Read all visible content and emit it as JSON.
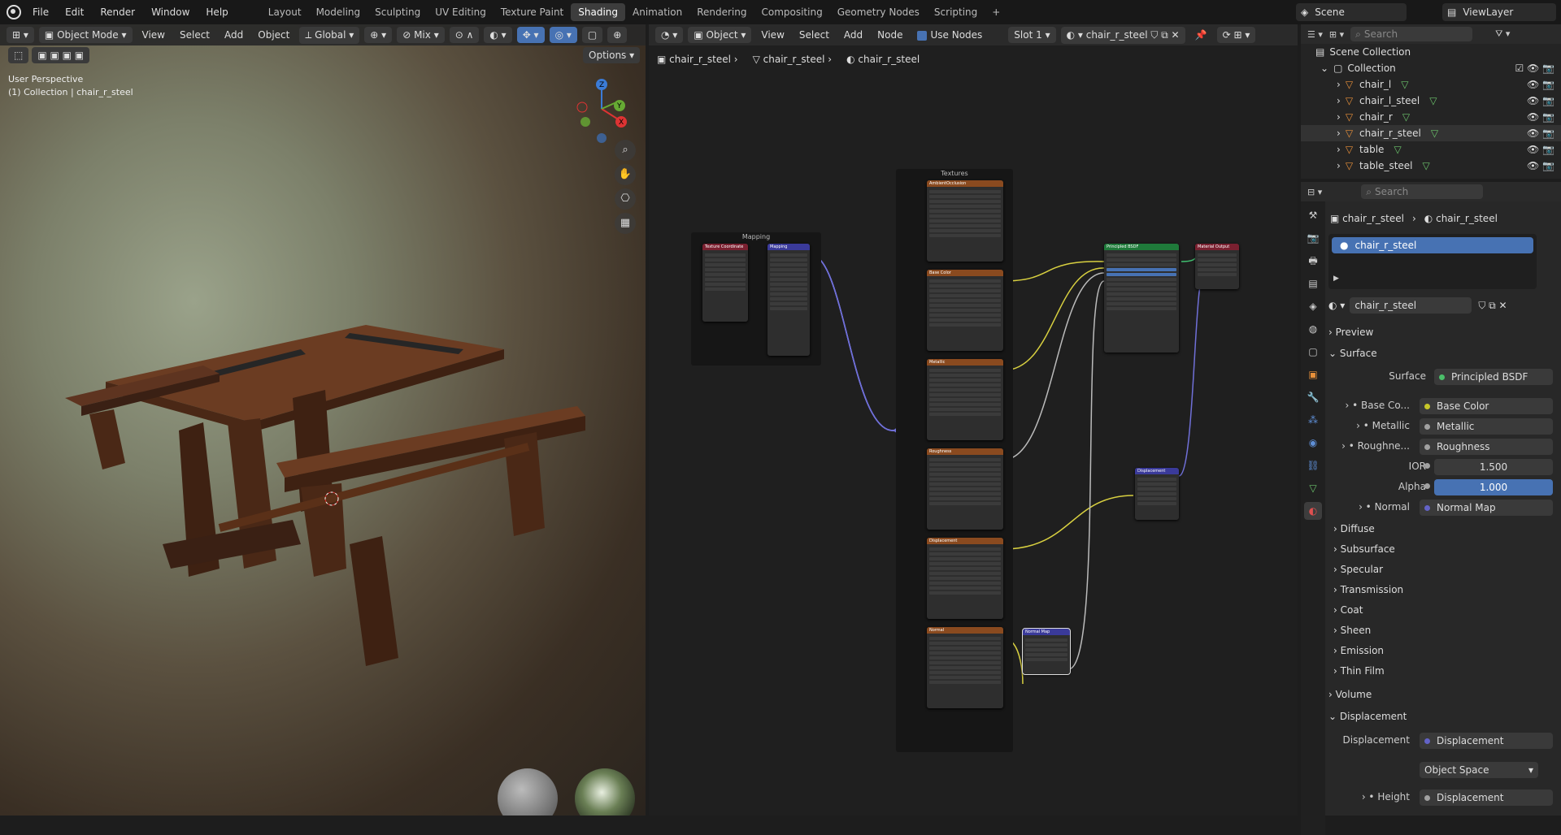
{
  "menu": [
    "File",
    "Edit",
    "Render",
    "Window",
    "Help"
  ],
  "workspaces": [
    "Layout",
    "Modeling",
    "Sculpting",
    "UV Editing",
    "Texture Paint",
    "Shading",
    "Animation",
    "Rendering",
    "Compositing",
    "Geometry Nodes",
    "Scripting"
  ],
  "active_workspace": "Shading",
  "add_tab": "+",
  "scene": "Scene",
  "view_layer": "ViewLayer",
  "viewport": {
    "mode": "Object Mode",
    "menus": [
      "View",
      "Select",
      "Add",
      "Object"
    ],
    "transform": "Global",
    "snap": "Mix",
    "options": "Options",
    "info_line1": "User Perspective",
    "info_line2": "(1) Collection | chair_r_steel",
    "gizmo": {
      "z": "Z",
      "y": "Y",
      "x": "X"
    }
  },
  "node_editor": {
    "type": "Object",
    "menus": [
      "View",
      "Select",
      "Add",
      "Node"
    ],
    "use_nodes": "Use Nodes",
    "slot": "Slot 1",
    "material": "chair_r_steel",
    "breadcrumb": [
      "chair_r_steel",
      "chair_r_steel",
      "chair_r_steel"
    ],
    "frames": {
      "mapping": "Mapping",
      "textures": "Textures"
    },
    "nodes": {
      "texcoord": "Texture Coordinate",
      "mapping": "Mapping",
      "ao": "AmbientOcclusion",
      "basecolor": "Base Color",
      "metallic": "Metallic",
      "roughness": "Roughness",
      "displacement": "Displacement",
      "normal": "Normal",
      "bsdf": "Principled BSDF",
      "output": "Material Output",
      "disp_node": "Displacement",
      "normal_map": "Normal Map"
    }
  },
  "outliner": {
    "search_placeholder": "Search",
    "root": "Scene Collection",
    "collection": "Collection",
    "items": [
      "chair_l",
      "chair_l_steel",
      "chair_r",
      "chair_r_steel",
      "table",
      "table_steel"
    ]
  },
  "properties": {
    "search_placeholder": "Search",
    "breadcrumb": [
      "chair_r_steel",
      "chair_r_steel"
    ],
    "slot_name": "chair_r_steel",
    "material_name": "chair_r_steel",
    "sections": {
      "preview": "Preview",
      "surface": "Surface",
      "volume": "Volume",
      "displacement": "Displacement"
    },
    "surface_label": "Surface",
    "surface_value": "Principled BSDF",
    "inputs": [
      {
        "label": "Base Co...",
        "value": "Base Color",
        "color": "#c7c729"
      },
      {
        "label": "Metallic",
        "value": "Metallic",
        "color": "#a1a1a1"
      },
      {
        "label": "Roughne...",
        "value": "Roughness",
        "color": "#a1a1a1"
      }
    ],
    "ior_label": "IOR",
    "ior_value": "1.500",
    "alpha_label": "Alpha",
    "alpha_value": "1.000",
    "normal_label": "Normal",
    "normal_value": "Normal Map",
    "subpanels": [
      "Diffuse",
      "Subsurface",
      "Specular",
      "Transmission",
      "Coat",
      "Sheen",
      "Emission",
      "Thin Film"
    ],
    "disp_label": "Displacement",
    "disp_value": "Displacement",
    "space_value": "Object Space",
    "height_label": "Height",
    "height_value": "Displacement"
  }
}
